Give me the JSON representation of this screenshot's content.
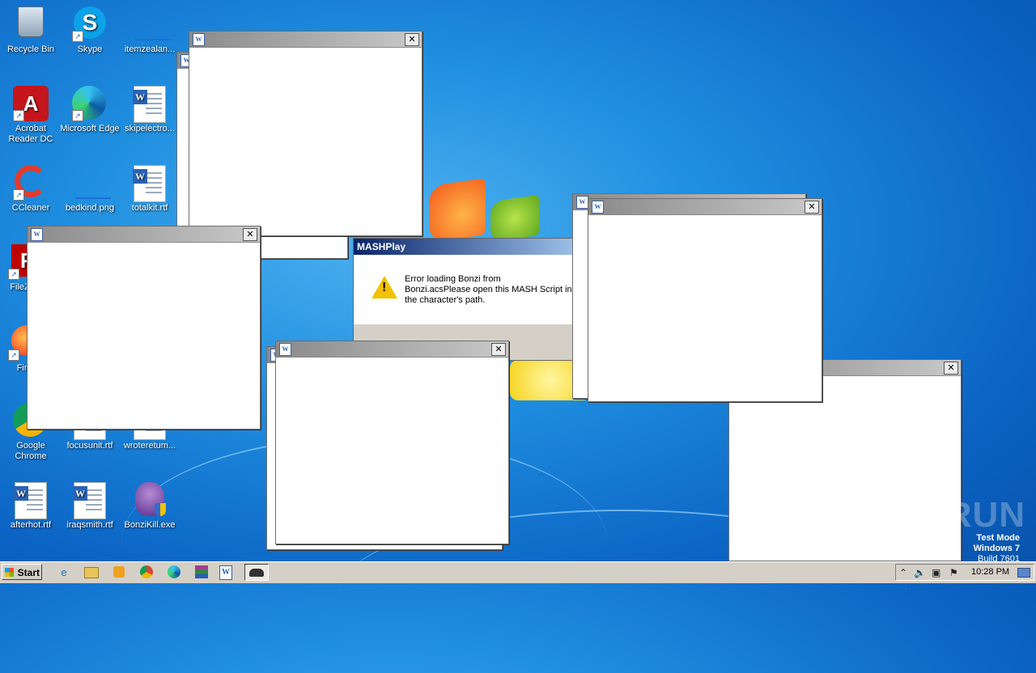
{
  "desktop": {
    "icons": [
      {
        "label": "Recycle Bin",
        "icon": "recycle-bin-icon"
      },
      {
        "label": "Skype",
        "icon": "skype-icon"
      },
      {
        "label": "itemzealan...",
        "icon": "file-icon"
      },
      {
        "label": "Acrobat Reader DC",
        "icon": "acrobat-icon"
      },
      {
        "label": "Microsoft Edge",
        "icon": "edge-icon"
      },
      {
        "label": "skipelectro...",
        "icon": "word-doc-icon"
      },
      {
        "label": "CCleaner",
        "icon": "ccleaner-icon"
      },
      {
        "label": "bedkind.png",
        "icon": "image-file-icon"
      },
      {
        "label": "totalkit.rtf",
        "icon": "word-doc-icon"
      },
      {
        "label": "FileZil",
        "icon": "filezilla-icon"
      },
      {
        "label": "Fir",
        "icon": "firefox-icon"
      },
      {
        "label": "Google Chrome",
        "icon": "chrome-icon"
      },
      {
        "label": "focusunit.rtf",
        "icon": "word-doc-icon"
      },
      {
        "label": "wroteretum...",
        "icon": "word-doc-icon"
      },
      {
        "label": "afterhot.rtf",
        "icon": "word-doc-icon"
      },
      {
        "label": "iraqsmith.rtf",
        "icon": "word-doc-icon"
      },
      {
        "label": "BonziKill.exe",
        "icon": "bonzi-icon"
      }
    ]
  },
  "dialog": {
    "title": "MASHPlay",
    "message_line1": "Error loading Bonzi from",
    "message_line2": "Bonzi.acsPlease open this MASH Script in a text",
    "message_line3": "the character's path."
  },
  "popup_windows": {
    "close_glyph": "✕",
    "app_icon_glyph": "W"
  },
  "taskbar": {
    "start_label": "Start",
    "clock": "10:28 PM"
  },
  "watermark": {
    "line1": "Test Mode",
    "line2": "Windows 7",
    "line3": "Build 7601"
  },
  "brand_watermark": "ANY▷RUN",
  "colors": {
    "desktop_blue": "#1f8fe0",
    "dialog_title": "#0a246a",
    "warning_yellow": "#f2c200"
  }
}
